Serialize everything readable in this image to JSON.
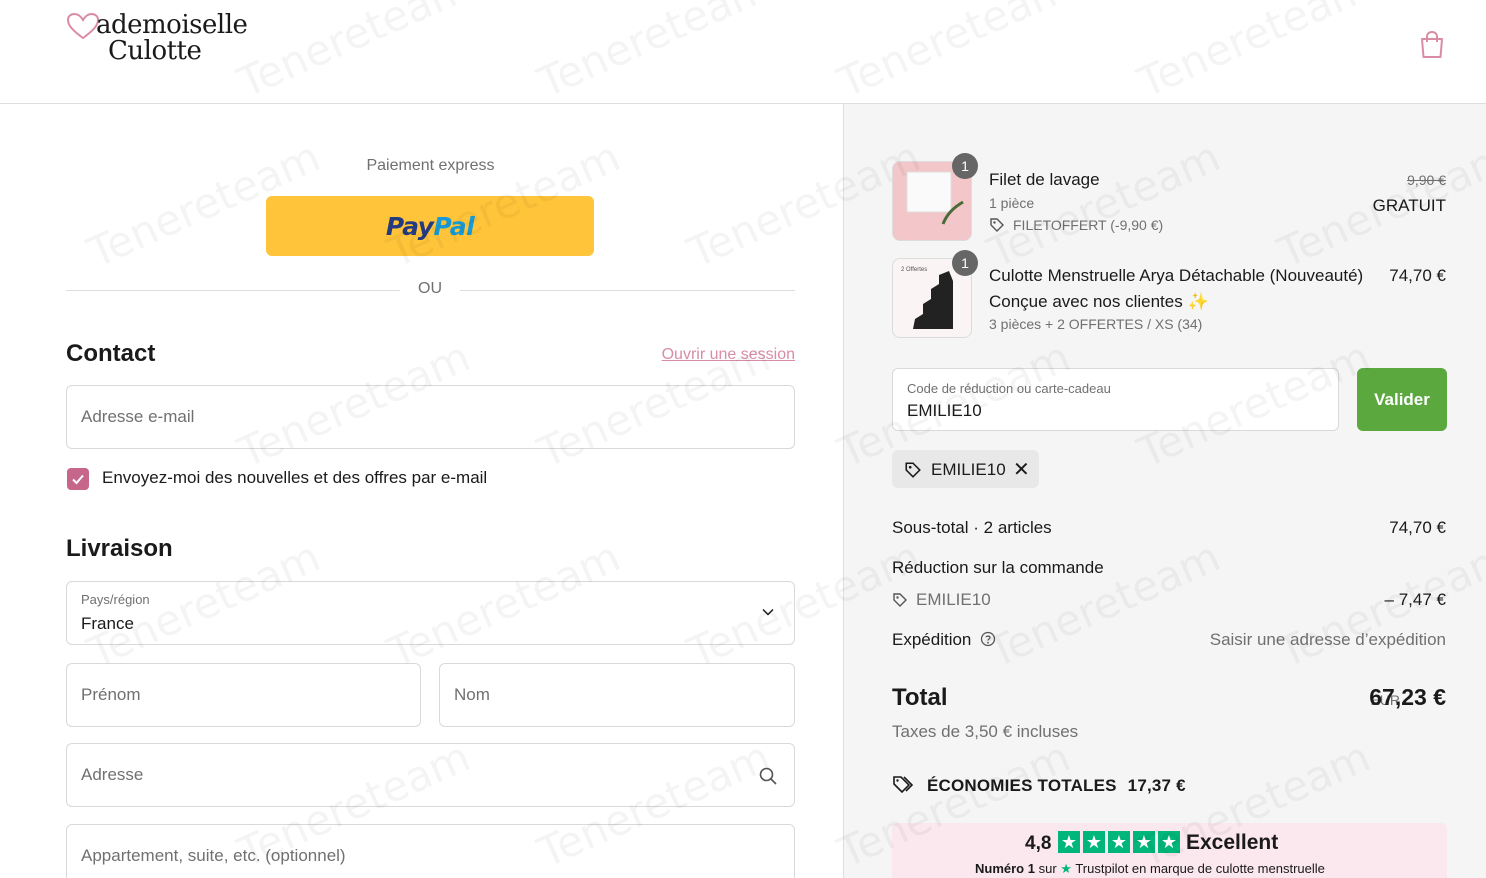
{
  "header": {
    "logo_line1": "ademoiselle",
    "logo_line2": "Culotte",
    "cart_icon": "shopping-bag-icon"
  },
  "express": {
    "label": "Paiement express",
    "paypal_pay": "Pay",
    "paypal_pal": "Pal",
    "or_label": "OU"
  },
  "contact": {
    "title": "Contact",
    "login_link": "Ouvrir une session",
    "email_placeholder": "Adresse e-mail",
    "newsletter_label": "Envoyez-moi des nouvelles et des offres par e-mail",
    "newsletter_checked": true
  },
  "delivery": {
    "title": "Livraison",
    "country_label": "Pays/région",
    "country_value": "France",
    "first_name_placeholder": "Prénom",
    "last_name_placeholder": "Nom",
    "address_placeholder": "Adresse",
    "apartment_placeholder": "Appartement, suite, etc. (optionnel)"
  },
  "cart": {
    "items": [
      {
        "name": "Filet de lavage",
        "quantity": "1",
        "meta": "1 pièce",
        "discount": "FILETOFFERT (-9,90 €)",
        "original_price": "9,90 €",
        "price": "GRATUIT"
      },
      {
        "name": "Culotte Menstruelle Arya Détachable (Nouveauté)",
        "quantity": "1",
        "subtitle": "Conçue avec nos clientes",
        "meta": "3 pièces + 2 OFFERTES / XS (34)",
        "price": "74,70 €",
        "thumb_text": "2 Offertes"
      }
    ]
  },
  "discount": {
    "label": "Code de réduction ou carte-cadeau",
    "value": "EMILIE10",
    "apply_button": "Valider",
    "applied_chip": "EMILIE10"
  },
  "summary": {
    "subtotal_label": "Sous-total · 2 articles",
    "subtotal_value": "74,70 €",
    "order_discount_label": "Réduction sur la commande",
    "order_discount_code": "EMILIE10",
    "order_discount_value": "– 7,47 €",
    "shipping_label": "Expédition",
    "shipping_value": "Saisir une adresse d’expédition",
    "total_label": "Total",
    "currency": "EUR",
    "total_value": "67,23 €",
    "tax_note": "Taxes de 3,50 € incluses",
    "savings_label": "ÉCONOMIES TOTALES",
    "savings_value": "17,37 €"
  },
  "trustpilot": {
    "rating": "4,8",
    "stars": 5,
    "verdict": "Excellent",
    "number_one": "Numéro 1",
    "sub_sur": "sur",
    "sub_rest": "Trustpilot en marque de culotte menstruelle",
    "star_color": "#00b67a"
  },
  "watermark_text": "Tenereteam",
  "colors": {
    "accent_pink": "#c5668a",
    "link_pink": "#d98da5",
    "paypal_yellow": "#ffc439",
    "valider_green": "#5aa83e"
  }
}
